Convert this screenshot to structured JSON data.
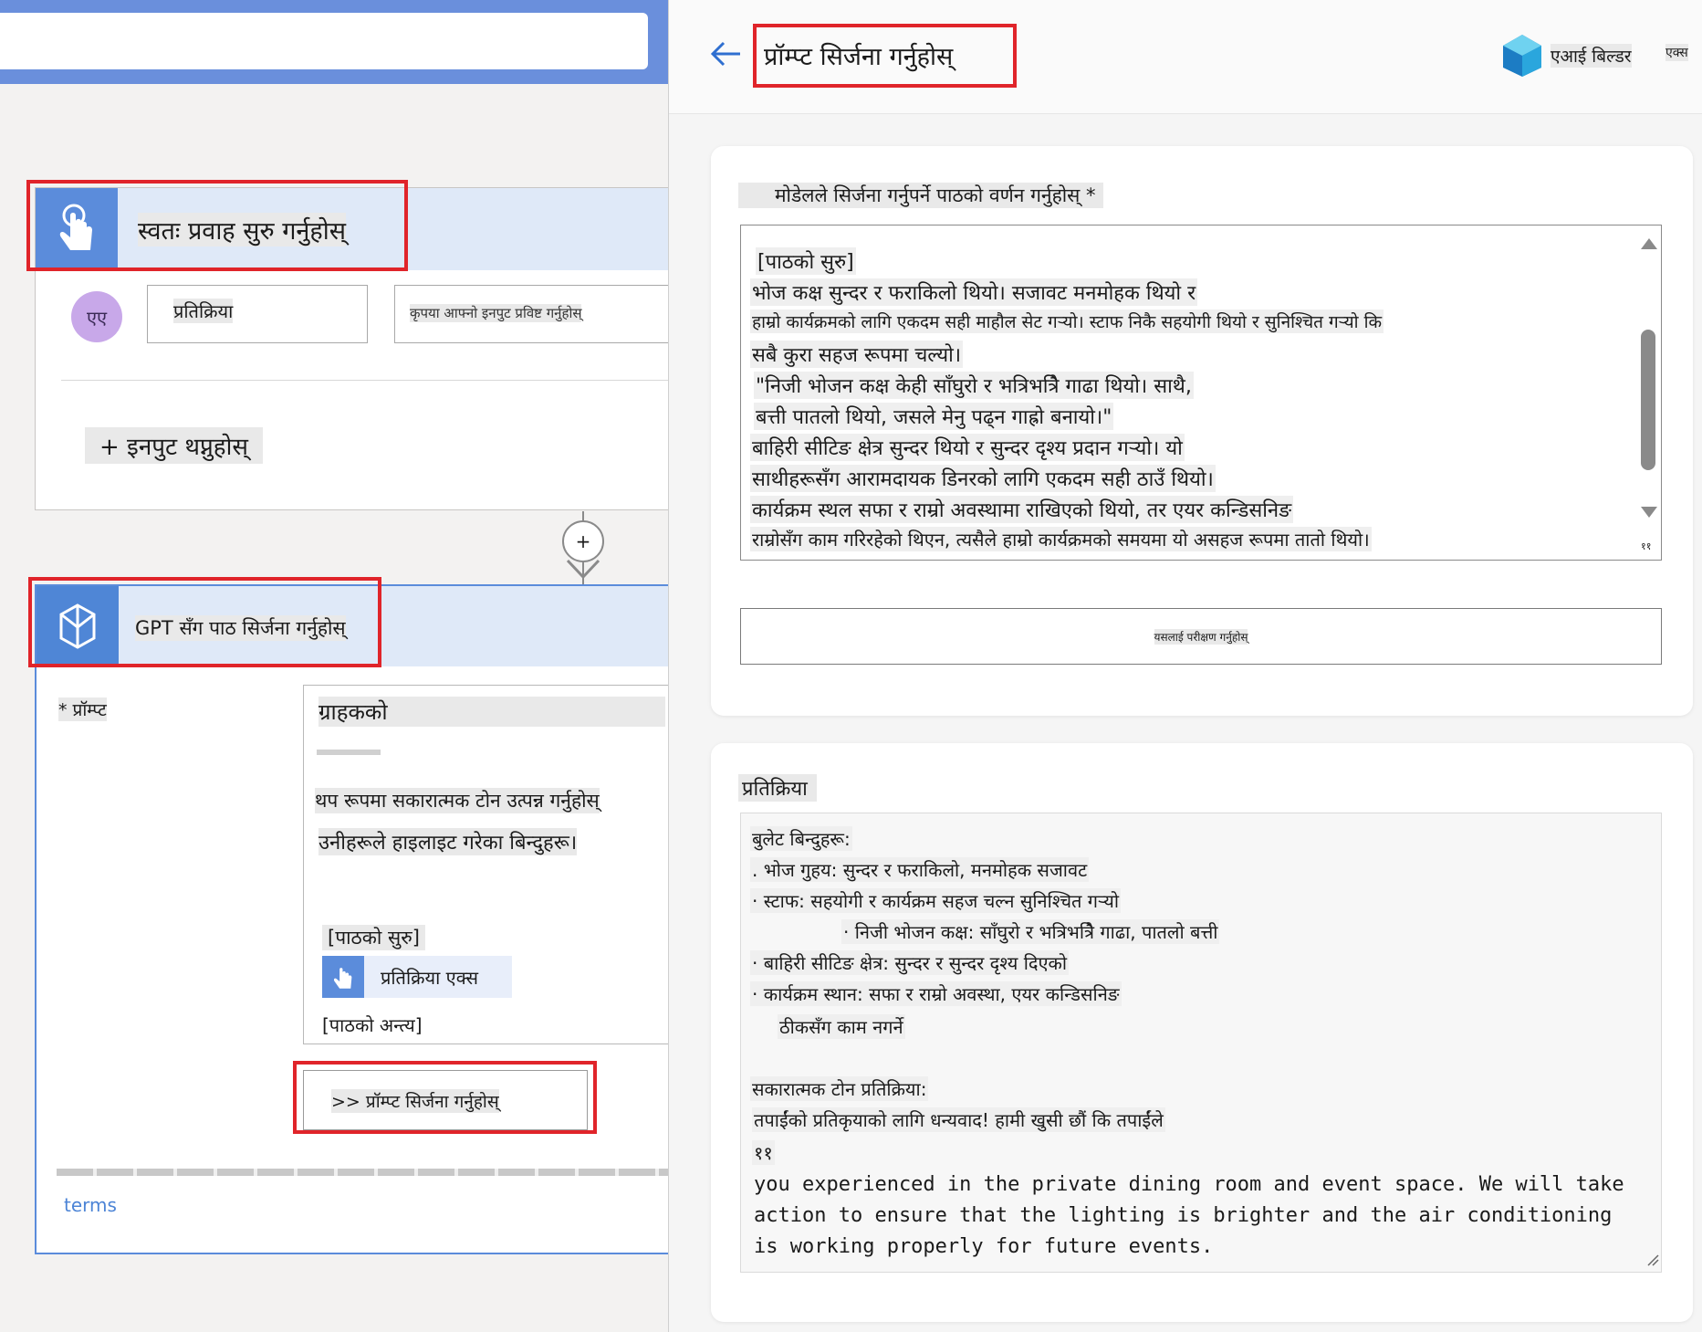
{
  "trigger_card": {
    "title": "स्वतः प्रवाह सुरु गर्नुहोस्",
    "avatar_initials": "एए",
    "input_name": "प्रतिक्रिया",
    "input_placeholder": "कृपया आफ्नो इनपुट प्रविष्ट गर्नुहोस्",
    "add_input_label": "+ इनपुट थप्नुहोस्"
  },
  "connector": {
    "plus": "+"
  },
  "gpt_card": {
    "title": "GPT सँग पाठ सिर्जना गर्नुहोस्",
    "prompt_label": "* प्रॉम्प्ट",
    "prompt_lines": [
      "ग्राहकको",
      "थप रूपमा सकारात्मक टोन उत्पन्न गर्नुहोस्",
      "उनीहरूले हाइलाइट गरेका बिन्दुहरू।"
    ],
    "text_start": "[पाठको सुरु]",
    "token_label": "प्रतिक्रिया एक्स",
    "text_end": "[पाठको अन्त्य]",
    "create_prompt_button": ">> प्रॉम्प्ट सिर्जना गर्नुहोस्",
    "terms_link": "terms"
  },
  "right_panel": {
    "title": "प्रॉम्प्ट सिर्जना गर्नुहोस्",
    "brand_name": "एआई बिल्डर",
    "close_label": "एक्स",
    "describe_label": "मोडेलले सिर्जना गर्नुपर्ने पाठको वर्णन गर्नुहोस् *",
    "prompt_text_lines": [
      "[पाठको सुरु]",
      "भोज कक्ष सुन्दर र फराकिलो थियो। सजावट मनमोहक थियो र",
      "हाम्रो कार्यक्रमको लागि एकदम सही माहौल सेट गर्‍यो। स्टाफ निकै सहयोगी थियो र सुनिश्चित गर्‍यो कि",
      "सबै कुरा सहज रूपमा चल्यो।",
      "\"निजी भोजन कक्ष केही साँघुरो र भत्रिभत्रिै गाढा थियो। साथै,",
      "बत्ती पातलो थियो, जसले मेनु पढ्न गाह्रो बनायो।\"",
      "बाहिरी सीटिङ क्षेत्र सुन्दर थियो र सुन्दर दृश्य प्रदान गर्‍यो। यो",
      "साथीहरूसँग आरामदायक डिनरको लागि एकदम सही ठाउँ थियो।",
      "कार्यक्रम स्थल सफा र राम्रो अवस्थामा राखिएको थियो, तर एयर कन्डिसनिङ",
      "राम्रोसँग काम गरिरहेको थिएन, त्यसैले हाम्रो कार्यक्रमको समयमा यो असहज रूपमा तातो थियो।"
    ],
    "scroll_counter": "११",
    "test_button": "यसलाई परीक्षण गर्नुहोस्",
    "response_label": "प्रतिक्रिया",
    "response_lines": [
      "बुलेट बिन्दुहरू:",
      ". भोज गुहय: सुन्दर र फराकिलो, मनमोहक सजावट",
      "· स्टाफ: सहयोगी र कार्यक्रम सहज चल्न सुनिश्चित गर्‍यो",
      "· निजी भोजन कक्ष: साँघुरो र भत्रिभत्रिै गाढा, पातलो बत्ती",
      "· बाहिरी सीटिङ क्षेत्र: सुन्दर र सुन्दर दृश्य दिएको",
      "· कार्यक्रम स्थान: सफा र राम्रो अवस्था, एयर कन्डिसनिङ",
      "ठीकसँग काम नगर्ने",
      "सकारात्मक टोन प्रतिक्रिया:",
      "तपाईंको प्रतिकृयाको लागि धन्यवाद! हामी खुसी छौं कि तपाईंले",
      "११"
    ],
    "response_english": "you experienced in the private dining room and event space. We will take action to ensure that the lighting is brighter and the air conditioning is working properly for future events."
  }
}
